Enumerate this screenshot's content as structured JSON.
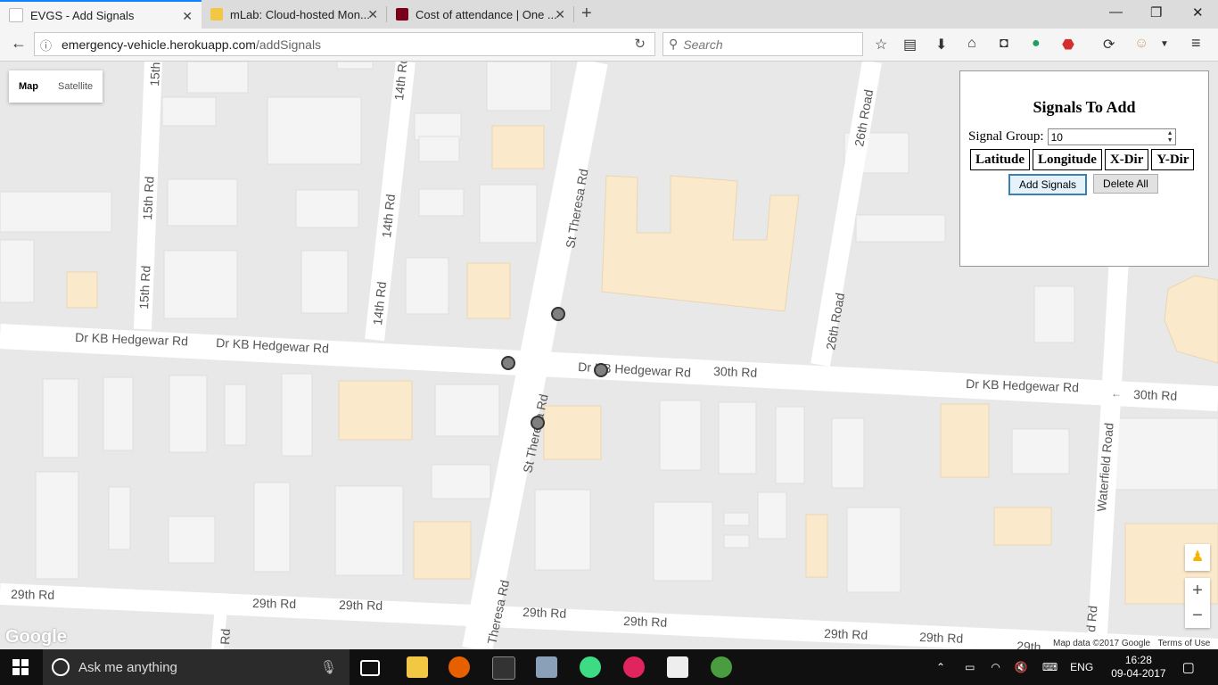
{
  "browser": {
    "tabs": [
      {
        "title": "EVGS - Add Signals",
        "active": true,
        "favicon_color": "#1a73e8"
      },
      {
        "title": "mLab: Cloud-hosted Mon...",
        "active": false,
        "favicon_color": "#f2c744"
      },
      {
        "title": "Cost of attendance | One ...",
        "active": false,
        "favicon_color": "#7a0019"
      }
    ],
    "url_host": "emergency-vehicle.herokuapp.com",
    "url_path": "/addSignals",
    "search_placeholder": "Search",
    "new_tab_glyph": "+",
    "window_controls": [
      "minimize-icon",
      "restore-icon",
      "close-icon"
    ]
  },
  "map": {
    "type_buttons": [
      "Map",
      "Satellite"
    ],
    "selected_type": "Map",
    "street_labels": [
      "15th Rd",
      "15th Rd",
      "15th Rd",
      "14th Rd",
      "14th Rd",
      "14th Rd",
      "St Theresa Rd",
      "26th Road",
      "26th Road",
      "Dr KB Hedgewar Rd",
      "Dr KB Hedgewar Rd",
      "Dr KB Hedgewar Rd",
      "Dr KB Hedgewar Rd",
      "30th Rd",
      "30th Rd",
      "St Theresa Rd",
      "Waterfield Road",
      "29th Rd",
      "29th Rd",
      "29th Rd",
      "29th Rd",
      "29th Rd",
      "29th Rd",
      "29th Rd",
      "Theresa Rd",
      "Rd",
      "d Rd",
      "29th"
    ],
    "signal_markers": 4,
    "logo": "Google",
    "attribution": "Map data ©2017 Google",
    "terms": "Terms of Use",
    "zoom_in": "+",
    "zoom_out": "−",
    "colors": {
      "road": "#ffffff",
      "background": "#e8e8e8",
      "building": "#f3f3f3",
      "highlight_building": "#fbe9cb",
      "marker": "#808080"
    }
  },
  "panel": {
    "title": "Signals To Add",
    "signal_group_label": "Signal Group:",
    "signal_group_value": "10",
    "columns": [
      "Latitude",
      "Longitude",
      "X-Dir",
      "Y-Dir"
    ],
    "add_button": "Add Signals",
    "delete_button": "Delete All"
  },
  "taskbar": {
    "search_placeholder": "Ask me anything",
    "language": "ENG",
    "time": "16:28",
    "date": "09-04-2017"
  }
}
